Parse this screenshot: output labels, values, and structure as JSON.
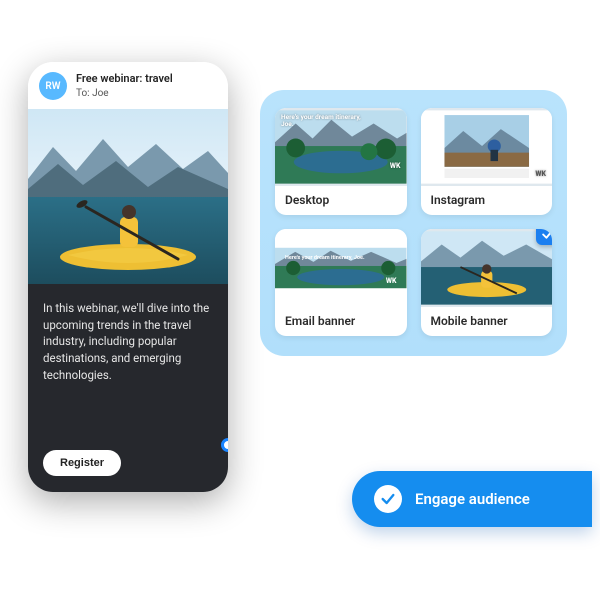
{
  "phone": {
    "avatar_initials": "RW",
    "subject": "Free webinar: travel",
    "to_line": "To: Joe",
    "body_text": "In this webinar, we'll dive into the upcoming trends in the travel industry, including popular destinations, and emerging technologies.",
    "register_label": "Register"
  },
  "panel": {
    "overlay_text": "Here's your dream itinerary, Joe.",
    "wk_mark": "WK",
    "cards": [
      {
        "label": "Desktop",
        "checked": false
      },
      {
        "label": "Instagram",
        "checked": false
      },
      {
        "label": "Email banner",
        "checked": false
      },
      {
        "label": "Mobile banner",
        "checked": true
      }
    ]
  },
  "pill": {
    "label": "Engage audience"
  }
}
